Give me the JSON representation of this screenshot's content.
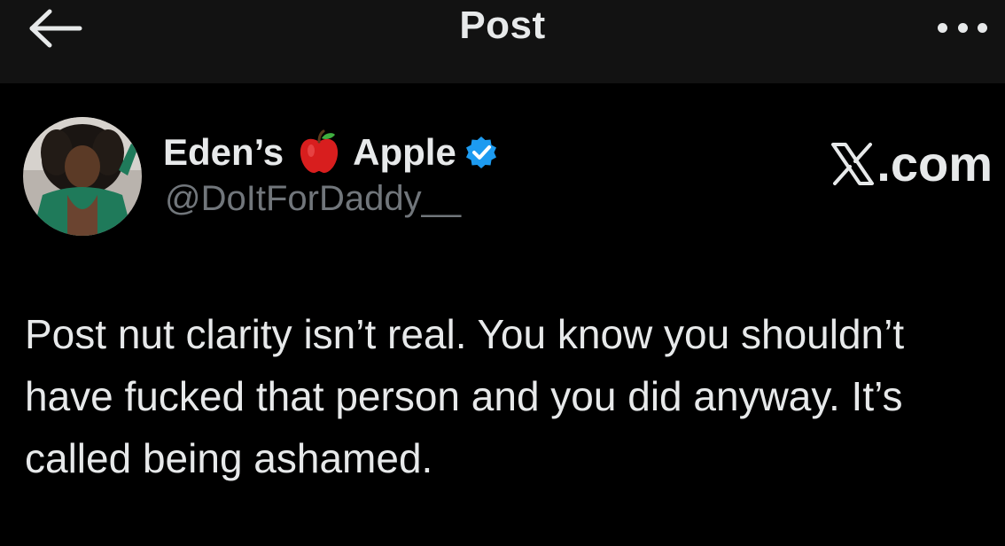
{
  "header": {
    "title": "Post",
    "back_icon": "arrow-left-icon",
    "more_icon": "more-horizontal-icon"
  },
  "author": {
    "name_part1": "Eden’s",
    "name_emoji": "apple-emoji",
    "name_part2": "Apple",
    "verified_icon": "verified-badge-icon",
    "verified_color": "#1d9bf0",
    "handle": "@DoItForDaddy__"
  },
  "watermark": {
    "text": ".com",
    "logo_icon": "x-logo-icon"
  },
  "post": {
    "text": "Post nut clarity isn’t real. You know you shouldn’t have fucked that person and you did anyway. It’s called being ashamed."
  },
  "colors": {
    "background": "#000000",
    "header_background": "#121212",
    "primary_text": "#e7e9ea",
    "secondary_text": "#71767b"
  }
}
